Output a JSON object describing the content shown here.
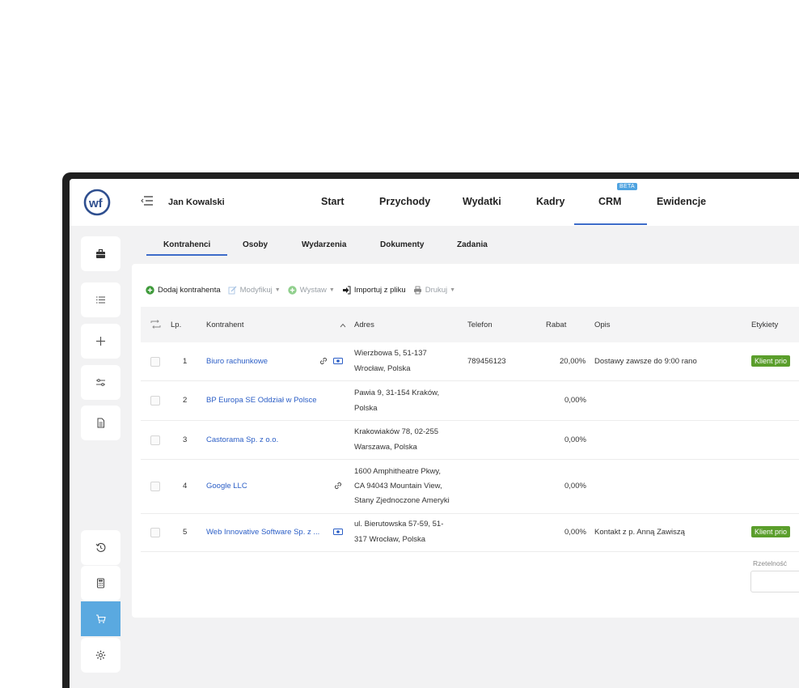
{
  "app": {
    "user_name": "Jan Kowalski"
  },
  "nav": {
    "items": [
      "Start",
      "Przychody",
      "Wydatki",
      "Kadry",
      "CRM",
      "Ewidencje"
    ],
    "active": "CRM",
    "beta_label": "BETA"
  },
  "subtabs": {
    "items": [
      "Kontrahenci",
      "Osoby",
      "Wydarzenia",
      "Dokumenty",
      "Zadania"
    ],
    "active": "Kontrahenci"
  },
  "toolbar": {
    "add": "Dodaj kontrahenta",
    "modify": "Modyfikuj",
    "issue": "Wystaw",
    "import": "Importuj z pliku",
    "print": "Drukuj"
  },
  "table": {
    "headers": {
      "lp": "Lp.",
      "contractor": "Kontrahent",
      "address": "Adres",
      "phone": "Telefon",
      "discount": "Rabat",
      "description": "Opis",
      "labels": "Etykiety"
    },
    "rows": [
      {
        "lp": "1",
        "name": "Biuro rachunkowe",
        "addr1": "Wierzbowa 5, 51-137",
        "addr2": "Wrocław, Polska",
        "addr3": "",
        "phone": "789456123",
        "discount": "20,00%",
        "description": "Dostawy zawsze do 9:00 rano",
        "label": "Klient prio"
      },
      {
        "lp": "2",
        "name": "BP Europa SE Oddział w Polsce",
        "addr1": "Pawia 9, 31-154 Kraków,",
        "addr2": "Polska",
        "addr3": "",
        "phone": "",
        "discount": "0,00%",
        "description": "",
        "label": ""
      },
      {
        "lp": "3",
        "name": "Castorama Sp. z o.o.",
        "addr1": "Krakowiaków 78, 02-255",
        "addr2": "Warszawa, Polska",
        "addr3": "",
        "phone": "",
        "discount": "0,00%",
        "description": "",
        "label": ""
      },
      {
        "lp": "4",
        "name": "Google LLC",
        "addr1": "1600 Amphitheatre Pkwy,",
        "addr2": "CA 94043 Mountain View,",
        "addr3": "Stany Zjednoczone Ameryki",
        "phone": "",
        "discount": "0,00%",
        "description": "",
        "label": ""
      },
      {
        "lp": "5",
        "name": "Web Innovative Software Sp. z ...",
        "addr1": "ul. Bierutowska 57-59, 51-",
        "addr2": "317 Wrocław, Polska",
        "addr3": "",
        "phone": "",
        "discount": "0,00%",
        "description": "Kontakt z p. Anną Zawiszą",
        "label": "Klient prio"
      }
    ]
  },
  "filter": {
    "reliability_label": "Rzetelność"
  },
  "colors": {
    "accent": "#3d6cc9",
    "link": "#2b5ec6",
    "tag": "#5a9e2b",
    "sidebar_active": "#5aa9e0",
    "add_icon": "#3e9a3a"
  },
  "icons": {
    "logo": "wf-logo",
    "sidebar": [
      "briefcase-icon",
      "list-icon",
      "plus-icon",
      "sliders-icon",
      "document-icon",
      "history-icon",
      "calculator-icon",
      "cart-icon",
      "settings-icon"
    ]
  }
}
